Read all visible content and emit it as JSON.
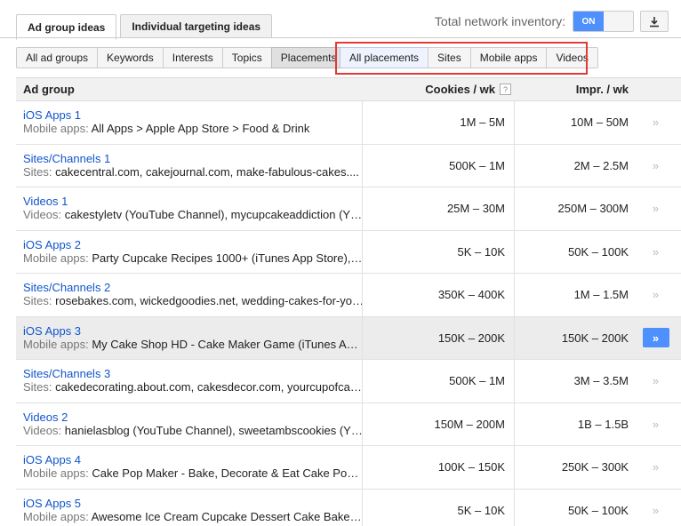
{
  "top_tabs": [
    {
      "label": "Ad group ideas",
      "active": true
    },
    {
      "label": "Individual targeting ideas",
      "active": false
    }
  ],
  "inventory": {
    "label": "Total network inventory:",
    "toggle_on": "ON",
    "download_icon": "download-icon"
  },
  "filter_tabs": [
    {
      "label": "All ad groups"
    },
    {
      "label": "Keywords"
    },
    {
      "label": "Interests"
    },
    {
      "label": "Topics"
    },
    {
      "label": "Placements",
      "selected": true
    }
  ],
  "placement_tabs": [
    {
      "label": "All placements",
      "selected": true
    },
    {
      "label": "Sites"
    },
    {
      "label": "Mobile apps"
    },
    {
      "label": "Videos"
    }
  ],
  "table": {
    "headers": {
      "ad_group": "Ad group",
      "cookies": "Cookies / wk",
      "help": "?",
      "impr": "Impr. / wk"
    },
    "rows": [
      {
        "name": "iOS Apps 1",
        "desc_label": "Mobile apps:",
        "desc": "All Apps > Apple App Store > Food & Drink",
        "cookies": "1M – 5M",
        "impr": "10M – 50M"
      },
      {
        "name": "Sites/Channels 1",
        "desc_label": "Sites:",
        "desc": "cakecentral.com, cakejournal.com, make-fabulous-cakes....",
        "cookies": "500K – 1M",
        "impr": "2M – 2.5M"
      },
      {
        "name": "Videos 1",
        "desc_label": "Videos:",
        "desc": "cakestyletv (YouTube Channel), mycupcakeaddiction (Y…",
        "cookies": "25M – 30M",
        "impr": "250M – 300M"
      },
      {
        "name": "iOS Apps 2",
        "desc_label": "Mobile apps:",
        "desc": "Party Cupcake Recipes 1000+ (iTunes App Store),…",
        "cookies": "5K – 10K",
        "impr": "50K – 100K"
      },
      {
        "name": "Sites/Channels 2",
        "desc_label": "Sites:",
        "desc": "rosebakes.com, wickedgoodies.net, wedding-cakes-for-yo…",
        "cookies": "350K – 400K",
        "impr": "1M – 1.5M"
      },
      {
        "name": "iOS Apps 3",
        "desc_label": "Mobile apps:",
        "desc": "My Cake Shop HD - Cake Maker Game (iTunes A…",
        "cookies": "150K – 200K",
        "impr": "150K – 200K",
        "hover": true
      },
      {
        "name": "Sites/Channels 3",
        "desc_label": "Sites:",
        "desc": "cakedecorating.about.com, cakesdecor.com, yourcupofca…",
        "cookies": "500K – 1M",
        "impr": "3M – 3.5M"
      },
      {
        "name": "Videos 2",
        "desc_label": "Videos:",
        "desc": "hanielasblog (YouTube Channel), sweetambscookies (Y…",
        "cookies": "150M – 200M",
        "impr": "1B – 1.5B"
      },
      {
        "name": "iOS Apps 4",
        "desc_label": "Mobile apps:",
        "desc": "Cake Pop Maker - Bake, Decorate & Eat Cake Po…",
        "cookies": "100K – 150K",
        "impr": "250K – 300K"
      },
      {
        "name": "iOS Apps 5",
        "desc_label": "Mobile apps:",
        "desc": "Awesome Ice Cream Cupcake Dessert Cake Bake…",
        "cookies": "5K – 10K",
        "impr": "50K – 100K"
      }
    ],
    "arrow_glyph": "»"
  }
}
